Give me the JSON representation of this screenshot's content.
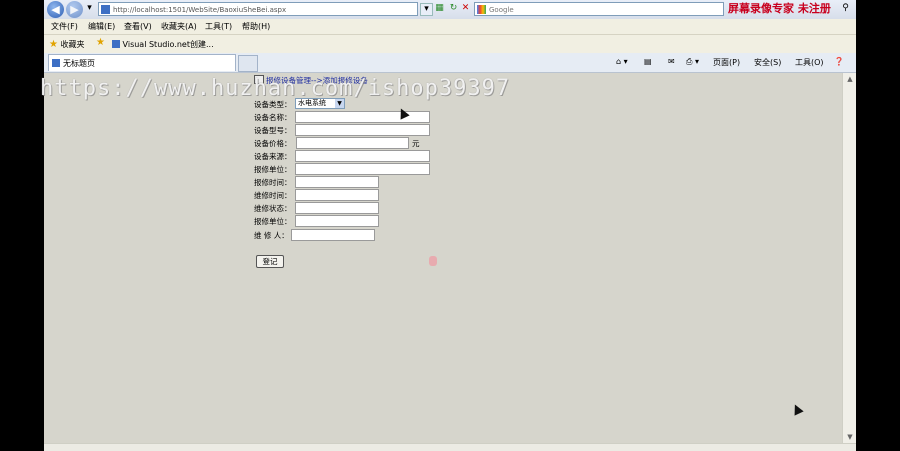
{
  "browser": {
    "address": "http://localhost:1501/WebSite/BaoxiuSheBei.aspx",
    "search_placeholder": "Google",
    "recorder_watermark": "屏幕录像专家  未注册"
  },
  "menu": [
    "文件(F)",
    "编辑(E)",
    "查看(V)",
    "收藏夹(A)",
    "工具(T)",
    "帮助(H)"
  ],
  "favorites": {
    "label": "收藏夹",
    "item": "Visual Studio.net创建..."
  },
  "tab": {
    "title": "无标题页"
  },
  "toolbar": {
    "page": "页面(P)",
    "safety": "安全(S)",
    "tools": "工具(O)"
  },
  "breadcrumb": "报修设备管理-->添加报修设备",
  "form": {
    "fields": [
      {
        "label": "设备类型：",
        "type": "select",
        "value": "水电系统"
      },
      {
        "label": "设备名称：",
        "type": "text",
        "value": ""
      },
      {
        "label": "设备型号：",
        "type": "text",
        "value": ""
      },
      {
        "label": "设备价格：",
        "type": "text",
        "value": "",
        "unit": "元"
      },
      {
        "label": "设备来源：",
        "type": "text",
        "value": ""
      },
      {
        "label": "报修单位：",
        "type": "text",
        "value": ""
      },
      {
        "label": "报修时间：",
        "type": "text",
        "value": ""
      },
      {
        "label": "维修时间：",
        "type": "text",
        "value": ""
      },
      {
        "label": "维修状态：",
        "type": "text",
        "value": ""
      },
      {
        "label": "报修单位：",
        "type": "text",
        "value": ""
      },
      {
        "label": "维 修 人：",
        "type": "text",
        "value": ""
      }
    ],
    "submit_label": "登记"
  },
  "watermark_overlay": "https://www.huzhan.com/ishop39397"
}
